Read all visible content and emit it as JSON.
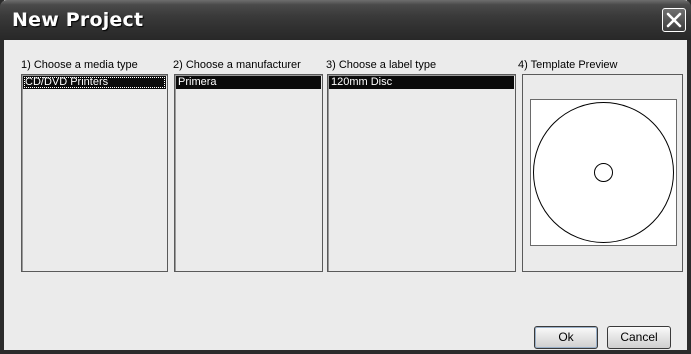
{
  "window": {
    "title": "New Project"
  },
  "sections": [
    {
      "label": "1) Choose a media type",
      "selected": "CD/DVD Printers"
    },
    {
      "label": "2) Choose a manufacturer",
      "selected": "Primera"
    },
    {
      "label": "3) Choose a label type",
      "selected": "120mm Disc"
    },
    {
      "label": "4) Template Preview"
    }
  ],
  "buttons": {
    "ok": "Ok",
    "cancel": "Cancel"
  },
  "icons": {
    "close": "close-icon",
    "preview": "disc-template-icon"
  },
  "colors": {
    "titlebar": "#303030",
    "selection": "#0a0a0a",
    "background": "#ebebeb"
  }
}
